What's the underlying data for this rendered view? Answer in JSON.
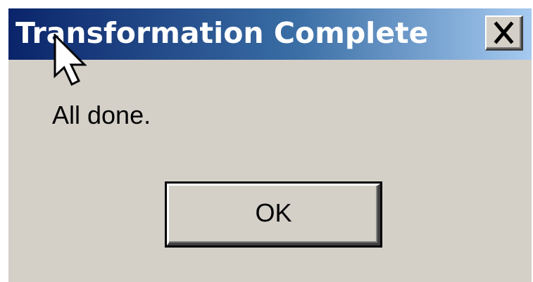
{
  "dialog": {
    "title": "Transformation Complete",
    "message": "All done.",
    "ok_label": "OK",
    "close_icon": "close-icon",
    "colors": {
      "title_gradient_start": "#0a246a",
      "title_gradient_end": "#a6caf0",
      "face": "#d4d0c8",
      "title_text": "#ffffff"
    }
  },
  "cursor": {
    "icon": "arrow-cursor-icon"
  }
}
